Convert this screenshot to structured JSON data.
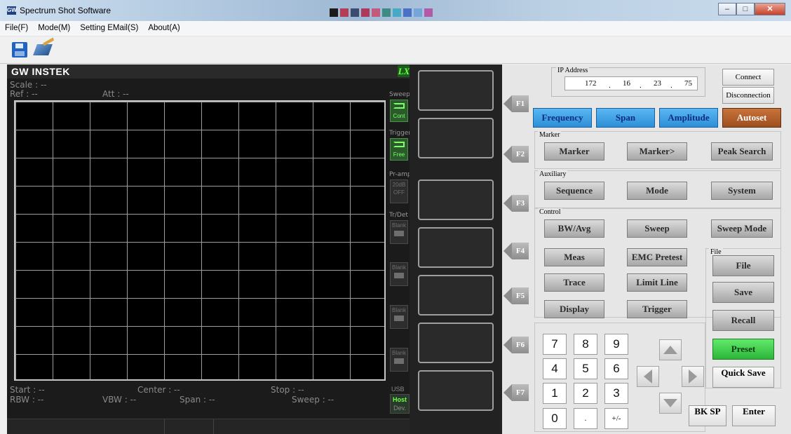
{
  "window": {
    "title": "Spectrum Shot Software",
    "app_icon": "GW"
  },
  "menu": [
    {
      "label": "File(F)"
    },
    {
      "label": "Mode(M)"
    },
    {
      "label": "Setting EMail(S)"
    },
    {
      "label": "About(A)"
    }
  ],
  "toolbar": {
    "icons": [
      "save-icon",
      "edit-icon"
    ]
  },
  "display": {
    "brand": "GW INSTEK",
    "lxi": "LXI",
    "scale": "Scale : --",
    "ref": "Ref : --",
    "att": "Att : --",
    "start": "Start : --",
    "center": "Center : --",
    "stop": "Stop : --",
    "rbw": "RBW : --",
    "vbw": "VBW : --",
    "span": "Span : --",
    "sweep": "Sweep : --",
    "side": {
      "sweep_label": "Sweep",
      "sweep_value": "Cont",
      "trigger_label": "Trigger",
      "trigger_value": "Free",
      "preamp_label": "Pr-amp",
      "preamp_l1": "20dB",
      "preamp_l2": "OFF",
      "trdet_label": "Tr/Det",
      "blank": "Blank",
      "usb_label": "USB",
      "usb_l1": "Host",
      "usb_l2": "Dev."
    }
  },
  "fkeys": [
    "F1",
    "F2",
    "F3",
    "F4",
    "F5",
    "F6",
    "F7"
  ],
  "panel": {
    "ip_legend": "IP Address",
    "ip": [
      "172",
      "16",
      "23",
      "75"
    ],
    "ip_dot": ".",
    "connect": "Connect",
    "disconnect": "Disconnection",
    "frequency": "Frequency",
    "span": "Span",
    "amplitude": "Amplitude",
    "autoset": "Autoset",
    "marker_group": "Marker",
    "marker": "Marker",
    "marker_to": "Marker>",
    "peak_search": "Peak Search",
    "aux_group": "Auxiliary",
    "sequence": "Sequence",
    "mode": "Mode",
    "system": "System",
    "control_group": "Control",
    "bw_avg": "BW/Avg",
    "sweep": "Sweep",
    "sweep_mode": "Sweep Mode",
    "meas": "Meas",
    "emc_pretest": "EMC Pretest",
    "trace": "Trace",
    "limit_line": "Limit Line",
    "display_btn": "Display",
    "trigger": "Trigger",
    "file_group": "File",
    "file": "File",
    "save": "Save",
    "recall": "Recall",
    "preset": "Preset",
    "quick_save": "Quick Save",
    "keypad": [
      "7",
      "8",
      "9",
      "4",
      "5",
      "6",
      "1",
      "2",
      "3",
      "0",
      ".",
      "+/-"
    ],
    "bksp": "BK SP",
    "enter": "Enter"
  }
}
